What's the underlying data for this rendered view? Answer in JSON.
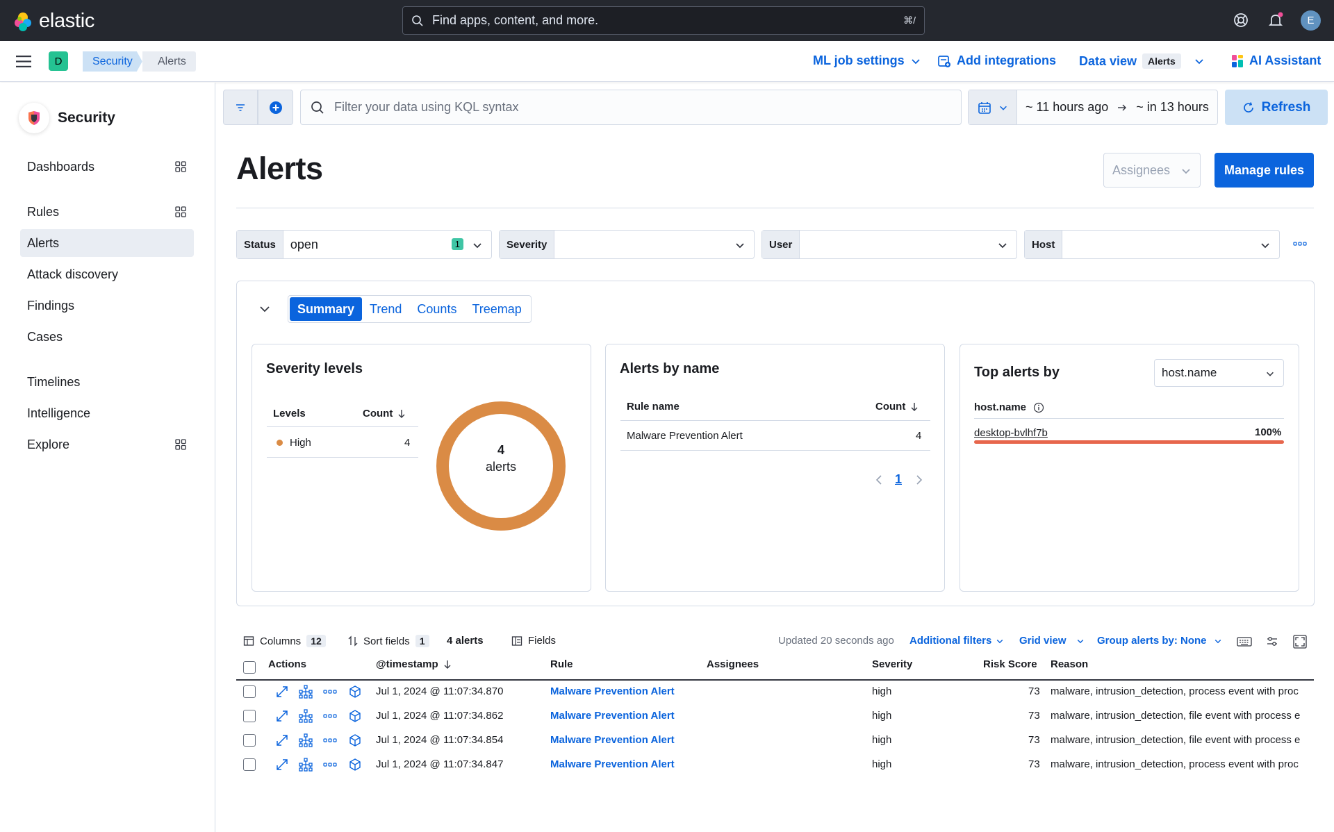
{
  "brand": {
    "name": "elastic"
  },
  "search": {
    "placeholder": "Find apps, content, and more.",
    "shortcut": "⌘/"
  },
  "user": {
    "initial": "E"
  },
  "space": {
    "initial": "D"
  },
  "breadcrumbs": [
    "Security",
    "Alerts"
  ],
  "header_nav": {
    "ml_job_settings": "ML job settings",
    "add_integrations": "Add integrations",
    "data_view_label": "Data view",
    "data_view_value": "Alerts",
    "ai_assistant": "AI Assistant"
  },
  "sidebar": {
    "title": "Security",
    "items": [
      {
        "label": "Dashboards",
        "icon": "apps-grid-icon"
      },
      {
        "label": "Rules",
        "icon": "apps-grid-icon"
      },
      {
        "label": "Alerts",
        "active": true
      },
      {
        "label": "Attack discovery"
      },
      {
        "label": "Findings"
      },
      {
        "label": "Cases"
      },
      {
        "label": "Timelines"
      },
      {
        "label": "Intelligence"
      },
      {
        "label": "Explore",
        "icon": "apps-grid-icon"
      }
    ]
  },
  "querybar": {
    "placeholder": "Filter your data using KQL syntax",
    "time_start": "~ 11 hours ago",
    "time_end": "~ in 13 hours",
    "refresh_label": "Refresh"
  },
  "page": {
    "title": "Alerts",
    "assignees_label": "Assignees",
    "manage_rules_label": "Manage rules"
  },
  "filters": [
    {
      "label": "Status",
      "value": "open",
      "count": "1"
    },
    {
      "label": "Severity",
      "value": ""
    },
    {
      "label": "User",
      "value": ""
    },
    {
      "label": "Host",
      "value": ""
    }
  ],
  "tabs": [
    "Summary",
    "Trend",
    "Counts",
    "Treemap"
  ],
  "severity_card": {
    "title": "Severity levels",
    "col_levels": "Levels",
    "col_count": "Count",
    "rows": [
      {
        "level": "High",
        "count": "4",
        "color": "#da8b45"
      }
    ],
    "donut_count": "4",
    "donut_label": "alerts"
  },
  "alerts_by_name": {
    "title": "Alerts by name",
    "col_rule": "Rule name",
    "col_count": "Count",
    "rows": [
      {
        "rule": "Malware Prevention Alert",
        "count": "4"
      }
    ],
    "page": "1"
  },
  "top_alerts": {
    "title": "Top alerts by",
    "select_value": "host.name",
    "col_field": "host.name",
    "rows": [
      {
        "name": "desktop-bvlhf7b",
        "pct": "100%",
        "fraction": 1.0
      }
    ]
  },
  "table_toolbar": {
    "columns_label": "Columns",
    "columns_count": "12",
    "sort_label": "Sort fields",
    "sort_count": "1",
    "alerts_count": "4 alerts",
    "fields_label": "Fields",
    "updated": "Updated 20 seconds ago",
    "additional_filters": "Additional filters",
    "grid_view": "Grid view",
    "group_by": "Group alerts by: None"
  },
  "table": {
    "columns": [
      "Actions",
      "@timestamp",
      "Rule",
      "Assignees",
      "Severity",
      "Risk Score",
      "Reason"
    ],
    "rows": [
      {
        "timestamp": "Jul 1, 2024 @ 11:07:34.870",
        "rule": "Malware Prevention Alert",
        "severity": "high",
        "risk": "73",
        "reason": "malware, intrusion_detection, process event with proc"
      },
      {
        "timestamp": "Jul 1, 2024 @ 11:07:34.862",
        "rule": "Malware Prevention Alert",
        "severity": "high",
        "risk": "73",
        "reason": "malware, intrusion_detection, file event with process e"
      },
      {
        "timestamp": "Jul 1, 2024 @ 11:07:34.854",
        "rule": "Malware Prevention Alert",
        "severity": "high",
        "risk": "73",
        "reason": "malware, intrusion_detection, file event with process e"
      },
      {
        "timestamp": "Jul 1, 2024 @ 11:07:34.847",
        "rule": "Malware Prevention Alert",
        "severity": "high",
        "risk": "73",
        "reason": "malware, intrusion_detection, process event with proc"
      }
    ]
  },
  "colors": {
    "accent": "#0b64dd",
    "high": "#da8b45",
    "topbar": "#25282f",
    "bar": "#e7664c"
  }
}
